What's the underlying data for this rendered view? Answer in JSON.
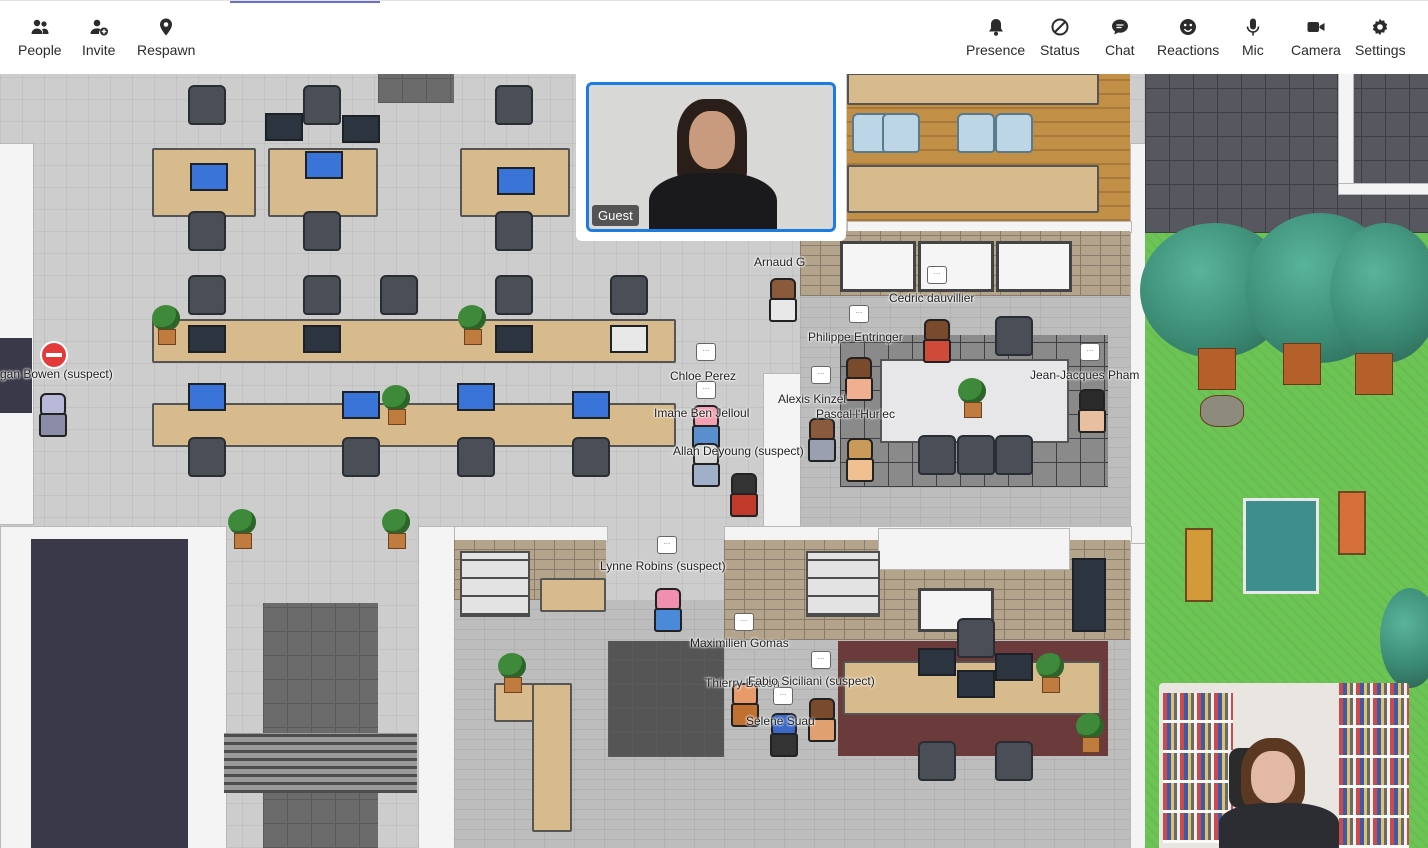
{
  "toolbar": {
    "left": [
      {
        "label": "People",
        "icon": "people-icon"
      },
      {
        "label": "Invite",
        "icon": "invite-icon"
      },
      {
        "label": "Respawn",
        "icon": "location-pin-icon"
      }
    ],
    "right": [
      {
        "label": "Presence",
        "icon": "bell-icon"
      },
      {
        "label": "Status",
        "icon": "status-slash-icon"
      },
      {
        "label": "Chat",
        "icon": "chat-bubble-icon"
      },
      {
        "label": "Reactions",
        "icon": "smiley-icon"
      },
      {
        "label": "Mic",
        "icon": "microphone-icon"
      },
      {
        "label": "Camera",
        "icon": "video-camera-icon"
      },
      {
        "label": "Settings",
        "icon": "gear-icon"
      }
    ]
  },
  "video": {
    "guest_label": "Guest"
  },
  "players": [
    {
      "name": "Arnaud G"
    },
    {
      "name": "Cedric dauvillier"
    },
    {
      "name": "Philippe Entringer"
    },
    {
      "name": "Chloe Perez"
    },
    {
      "name": "Jean-Jacques Pham"
    },
    {
      "name": "Alexis Kinzel"
    },
    {
      "name": "Pascal l'Hurlec"
    },
    {
      "name": "Imane Ben Jelloul"
    },
    {
      "name": "Allan Deyoung (suspect)"
    },
    {
      "name": "gan Bowen (suspect)"
    },
    {
      "name": "Lynne Robins (suspect)"
    },
    {
      "name": "Maximilien Gomas"
    },
    {
      "name": "Thierry Bacon"
    },
    {
      "name": "Fabio Siciliani (suspect)"
    },
    {
      "name": "Selene Suau"
    }
  ],
  "colors": {
    "accent_blue": "#1c7ce0",
    "toolbar_text": "#2b2b2b",
    "grass": "#6cc454",
    "do_not_enter_red": "#e23b3b"
  }
}
